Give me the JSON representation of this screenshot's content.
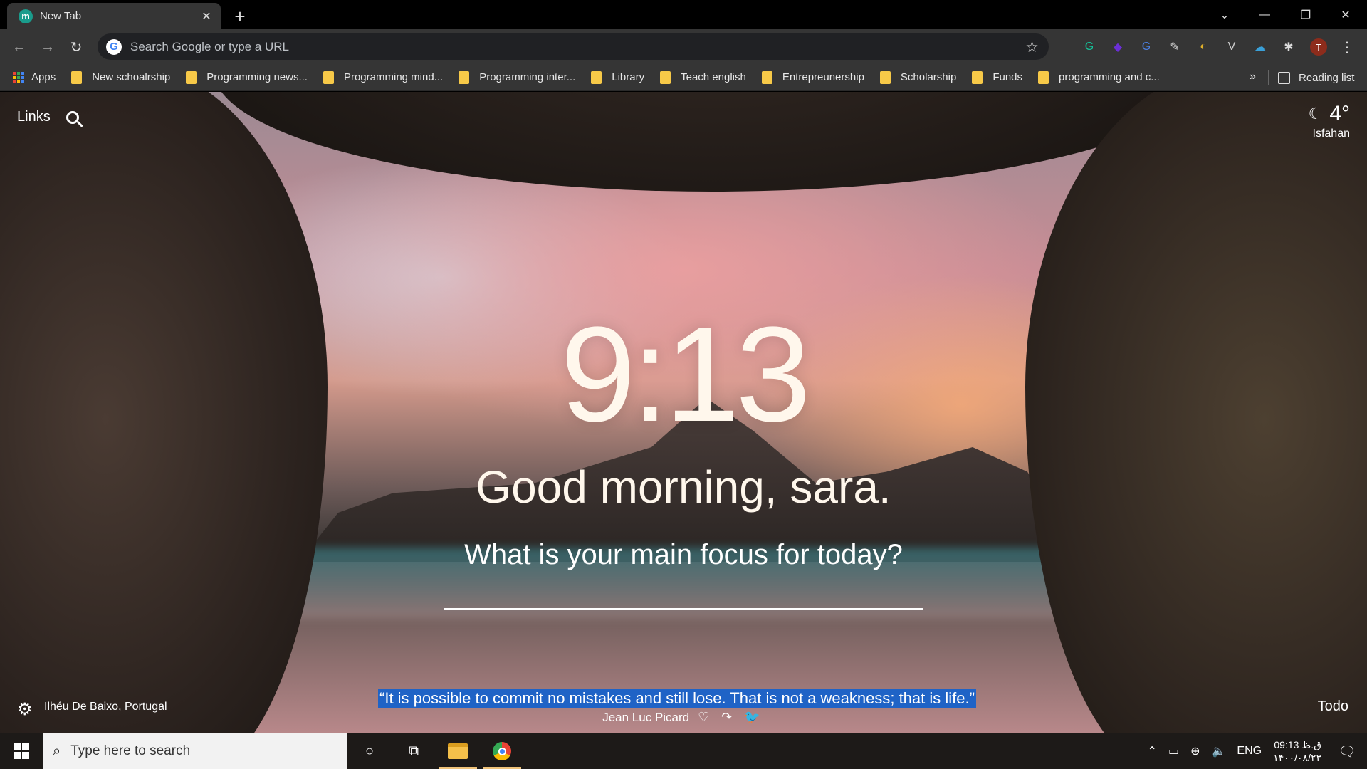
{
  "tab": {
    "favicon": "m",
    "title": "New Tab",
    "close": "✕",
    "new_tab": "+"
  },
  "window": {
    "tab_search": "⌄",
    "minimize": "—",
    "restore": "❐",
    "close": "✕"
  },
  "toolbar": {
    "back": "←",
    "forward": "→",
    "reload": "↻",
    "omnibox_placeholder": "Search Google or type a URL",
    "google_icon": "G",
    "bookmark_star": "☆",
    "avatar_letter": "T",
    "menu": "⋮"
  },
  "extensions": [
    {
      "name": "grammarly-icon",
      "glyph": "G",
      "color": "#15c39a"
    },
    {
      "name": "purple-gem-icon",
      "glyph": "◆",
      "color": "#6b2fd6"
    },
    {
      "name": "translate-icon",
      "glyph": "G",
      "color": "#4a7fe0"
    },
    {
      "name": "pen-icon",
      "glyph": "✎",
      "color": "#dddddd"
    },
    {
      "name": "color-picker-icon",
      "glyph": "◐",
      "color": "#e0b02a"
    },
    {
      "name": "v-icon",
      "glyph": "V",
      "color": "#cccccc"
    },
    {
      "name": "cloud-icon",
      "glyph": "☁",
      "color": "#3aa0d8"
    },
    {
      "name": "puzzle-icon",
      "glyph": "✱",
      "color": "#dddddd"
    }
  ],
  "bookmarks": {
    "apps_label": "Apps",
    "items": [
      "New schoalrship",
      "Programming news...",
      "Programming mind...",
      "Programming inter...",
      "Library",
      "Teach english",
      "Entrepreunership",
      "Scholarship",
      "Funds",
      "programming and c..."
    ],
    "more": "»",
    "reading_list": "Reading list"
  },
  "momentum": {
    "links_label": "Links",
    "weather": {
      "icon": "☾",
      "temp": "4°",
      "city": "Isfahan"
    },
    "time": "9:13",
    "greeting": "Good morning, sara.",
    "focus_prompt": "What is your main focus for today?",
    "location": "Ilhéu De Baixo, Portugal",
    "quote": "“It is possible to commit no mistakes and still lose. That is not a weakness; that is life.”",
    "author": "Jean Luc Picard",
    "quote_icons": "♡ ↷ 🐦",
    "todo_label": "Todo",
    "settings_icon": "⚙"
  },
  "taskbar": {
    "search_placeholder": "Type here to search",
    "cortana": "○",
    "task_view": "⧉",
    "tray": {
      "up_arrow": "⌃",
      "battery": "▭",
      "network": "⊕",
      "volume": "🔈",
      "lang": "ENG",
      "time": "09:13 ق.ظ",
      "date": "۱۴۰۰/۰۸/۲۳",
      "notifications": "🗨"
    }
  }
}
